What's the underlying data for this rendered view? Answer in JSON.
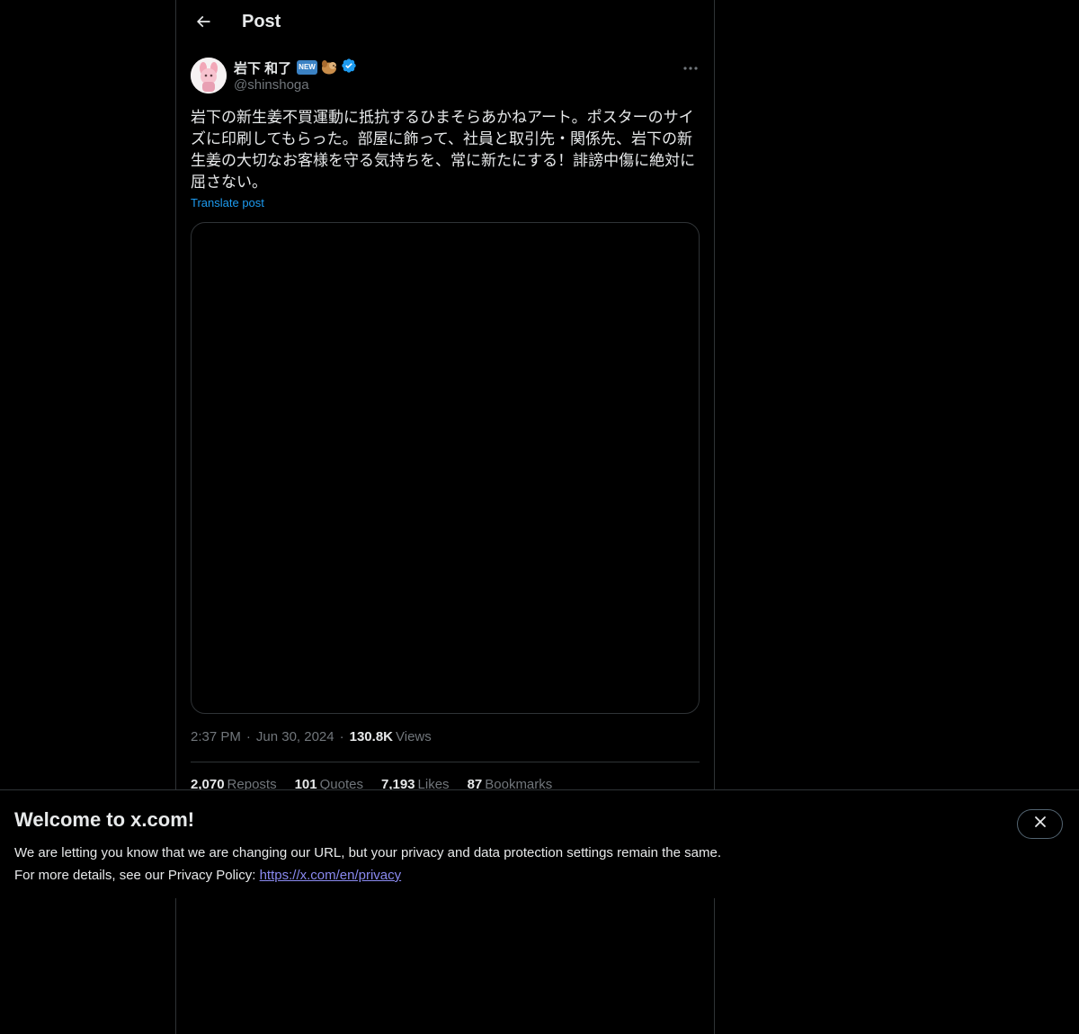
{
  "header": {
    "title": "Post",
    "back_icon": "arrow-left-icon"
  },
  "author": {
    "display_name": "岩下 和了",
    "badge_new": "NEW",
    "handle": "@shinshoga",
    "verified": true,
    "verified_color": "#1d9bf0"
  },
  "post": {
    "text": "岩下の新生姜不買運動に抵抗するひまそらあかねアート。ポスターのサイ\nズに印刷してもらった。部屋に飾って、社員と取引先・関係先、岩下の新\n生姜の大切なお客様を守る気持ちを、常に新たにする！誹謗中傷に絶対に\n屈さない。",
    "translate_label": "Translate post",
    "time": "2:37 PM",
    "date": "Jun 30, 2024",
    "views_count": "130.8K",
    "views_label": "Views"
  },
  "stats": {
    "reposts_count": "2,070",
    "reposts_label": "Reposts",
    "quotes_count": "101",
    "quotes_label": "Quotes",
    "likes_count": "7,193",
    "likes_label": "Likes",
    "bookmarks_count": "87",
    "bookmarks_label": "Bookmarks"
  },
  "banner": {
    "title": "Welcome to x.com!",
    "line1": "We are letting you know that we are changing our URL, but your privacy and data protection settings remain the same.",
    "line2_prefix": "For more details, see our Privacy Policy: ",
    "link_text": "https://x.com/en/privacy",
    "close_icon": "close-icon"
  },
  "colors": {
    "background": "#000000",
    "text_primary": "#e7e9ea",
    "text_secondary": "#71767b",
    "accent": "#1d9bf0",
    "border": "#2f3336"
  }
}
